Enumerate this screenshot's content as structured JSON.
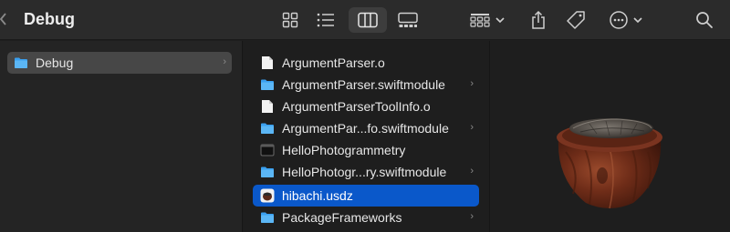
{
  "window": {
    "title": "Debug"
  },
  "toolbar": {
    "buttons": [
      {
        "name": "icon-view",
        "icon": "grid-icon"
      },
      {
        "name": "list-view",
        "icon": "list-icon"
      },
      {
        "name": "column-view",
        "icon": "columns-icon",
        "active": true
      },
      {
        "name": "gallery-view",
        "icon": "gallery-icon"
      },
      {
        "name": "group-menu",
        "icon": "group-icon"
      },
      {
        "name": "share",
        "icon": "share-icon"
      },
      {
        "name": "tag",
        "icon": "tag-icon"
      },
      {
        "name": "more-menu",
        "icon": "ellipsis-icon"
      },
      {
        "name": "search",
        "icon": "search-icon"
      }
    ]
  },
  "sidebar_column": {
    "items": [
      {
        "label": "Debug",
        "type": "folder",
        "has_children": true,
        "selected": true
      }
    ]
  },
  "file_column": {
    "items": [
      {
        "label": "ArgumentParser.o",
        "type": "file",
        "has_children": false
      },
      {
        "label": "ArgumentParser.swiftmodule",
        "type": "folder",
        "has_children": true
      },
      {
        "label": "ArgumentParserToolInfo.o",
        "type": "file",
        "has_children": false
      },
      {
        "label": "ArgumentPar...fo.swiftmodule",
        "type": "folder",
        "has_children": true
      },
      {
        "label": "HelloPhotogrammetry",
        "type": "executable",
        "has_children": false
      },
      {
        "label": "HelloPhotogr...ry.swiftmodule",
        "type": "folder",
        "has_children": true
      },
      {
        "label": "hibachi.usdz",
        "type": "usdz",
        "has_children": false,
        "selected": true
      },
      {
        "label": "PackageFrameworks",
        "type": "folder",
        "has_children": true
      }
    ]
  },
  "preview": {
    "subject": "3d-model-hibachi"
  },
  "colors": {
    "accent": "#0a58ca",
    "folder": "#3aa0f0",
    "toolbar": "#2b2b2b",
    "background": "#1e1e1e"
  }
}
